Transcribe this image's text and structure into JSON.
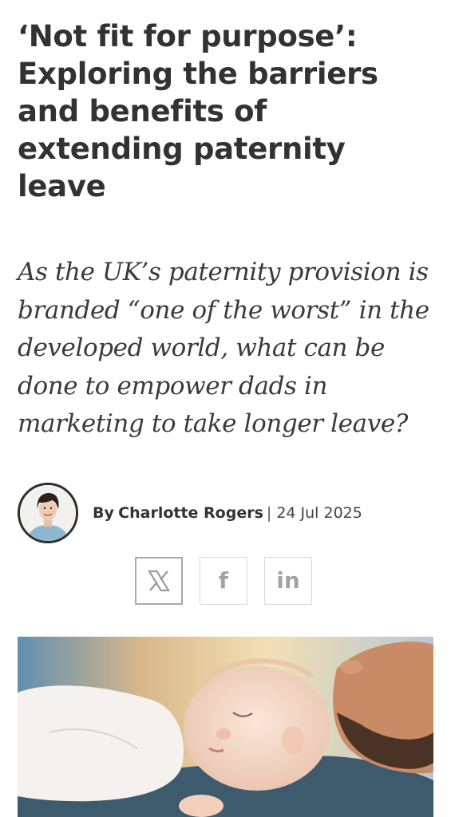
{
  "article": {
    "headline": "‘Not fit for purpose’: Exploring the barriers and benefits of extending paternity leave",
    "standfirst": "As the UK’s paternity provision is branded “one of the worst” in the developed world, what can be done to empower dads in marketing to take longer leave?",
    "byline": {
      "prefix": "By",
      "author": "Charlotte Rogers",
      "separator": "|",
      "date": "24 Jul 2025",
      "avatar_icon": "author-portrait"
    },
    "share": {
      "buttons": [
        {
          "network": "X",
          "icon": "x-logo-icon",
          "glyph": "X"
        },
        {
          "network": "Facebook",
          "icon": "facebook-icon",
          "glyph": "f"
        },
        {
          "network": "LinkedIn",
          "icon": "linkedin-icon",
          "glyph": "in"
        }
      ]
    },
    "hero_image": {
      "subject": "baby-sleeping-on-father-chest"
    }
  },
  "colors": {
    "text_dark": "#323232",
    "share_border": "#d8d8d8",
    "share_glyph": "#a3a3a3"
  }
}
